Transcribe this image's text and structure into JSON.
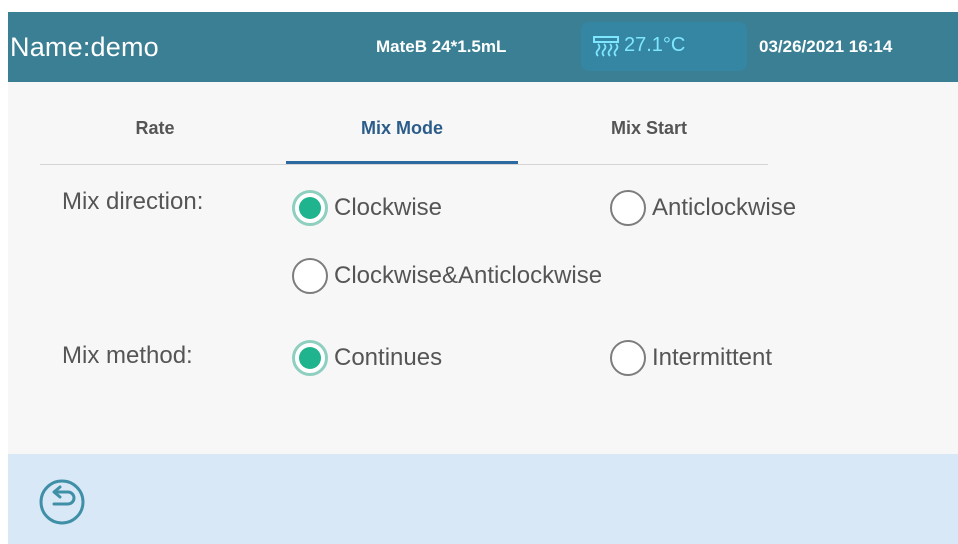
{
  "header": {
    "name": "Name:demo",
    "rotor": "MateB 24*1.5mL",
    "temperature": "27.1°C",
    "temperature_icon": "heater-icon",
    "datetime": "03/26/2021 16:14"
  },
  "tabs": [
    {
      "label": "Rate",
      "active": false
    },
    {
      "label": "Mix Mode",
      "active": true
    },
    {
      "label": "Mix Start",
      "active": false
    }
  ],
  "mix_direction": {
    "label": "Mix direction:",
    "options": [
      {
        "label": "Clockwise",
        "checked": true
      },
      {
        "label": "Anticlockwise",
        "checked": false
      },
      {
        "label": "Clockwise&Anticlockwise",
        "checked": false
      }
    ]
  },
  "mix_method": {
    "label": "Mix method:",
    "options": [
      {
        "label": "Continues",
        "checked": true
      },
      {
        "label": "Intermittent",
        "checked": false
      }
    ]
  },
  "footer": {
    "back_icon": "back-arrow-icon"
  },
  "colors": {
    "header_bg": "#3a7f93",
    "temp_text": "#7fe6ff",
    "radio_checked": "#1fb48d",
    "footer_bg": "#d9e8f7",
    "active_tab": "#2c5d8a"
  }
}
